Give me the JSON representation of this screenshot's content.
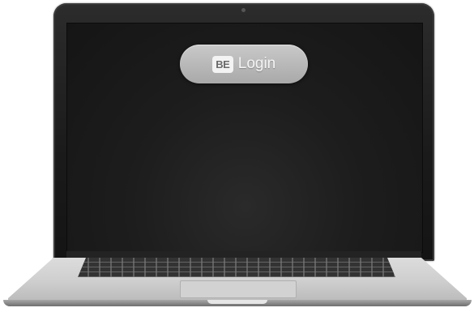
{
  "login_button": {
    "badge": "BE",
    "label": "Login"
  },
  "colors": {
    "pill": "#b8b8b8",
    "screen": "#1a1a1a",
    "body": "#d0d0d0"
  }
}
